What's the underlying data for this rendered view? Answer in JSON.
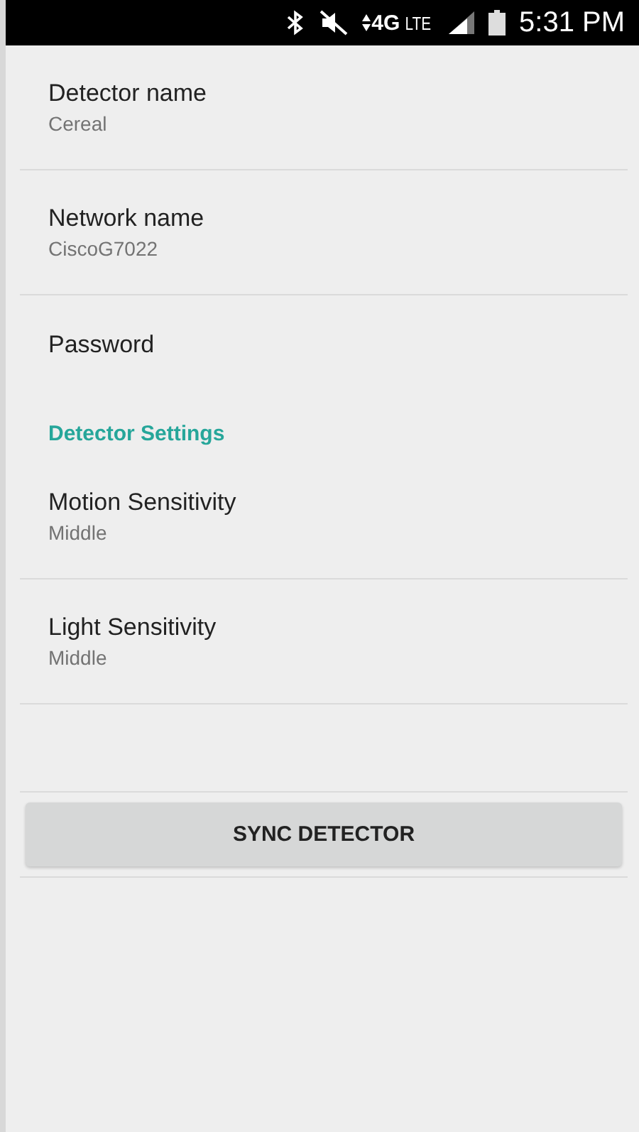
{
  "status_bar": {
    "network": "4G",
    "network_sub": "LTE",
    "time": "5:31 PM"
  },
  "sections": [
    {
      "items": [
        {
          "title": "Detector name",
          "summary": "Cereal",
          "divider": true
        },
        {
          "title": "Network name",
          "summary": "CiscoG7022",
          "divider": true
        },
        {
          "title": "Password",
          "divider": false
        }
      ]
    },
    {
      "header": "Detector Settings",
      "items": [
        {
          "title": "Motion Sensitivity",
          "summary": "Middle",
          "divider": true
        },
        {
          "title": "Light Sensitivity",
          "summary": "Middle",
          "divider": true
        }
      ]
    }
  ],
  "button": {
    "label": "SYNC DETECTOR"
  }
}
